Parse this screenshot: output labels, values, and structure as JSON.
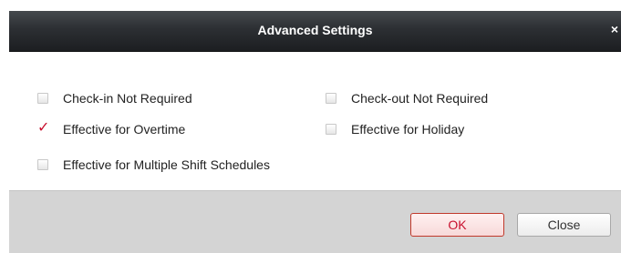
{
  "window": {
    "title": "Advanced Settings",
    "close_glyph": "×"
  },
  "options": [
    {
      "label": "Check-in Not Required",
      "checked": false
    },
    {
      "label": "Check-out Not Required",
      "checked": false
    },
    {
      "label": "Effective for Overtime",
      "checked": true
    },
    {
      "label": "Effective for Holiday",
      "checked": false
    },
    {
      "label": "Effective for Multiple Shift Schedules",
      "checked": false
    }
  ],
  "check_mark": "✓",
  "buttons": {
    "ok_label": "OK",
    "close_label": "Close"
  },
  "colors": {
    "accent": "#c8102e",
    "titlebar": "#2c2f33",
    "footer": "#d4d4d4"
  },
  "icons": {
    "close": "close-icon",
    "check": "checkmark-icon"
  }
}
